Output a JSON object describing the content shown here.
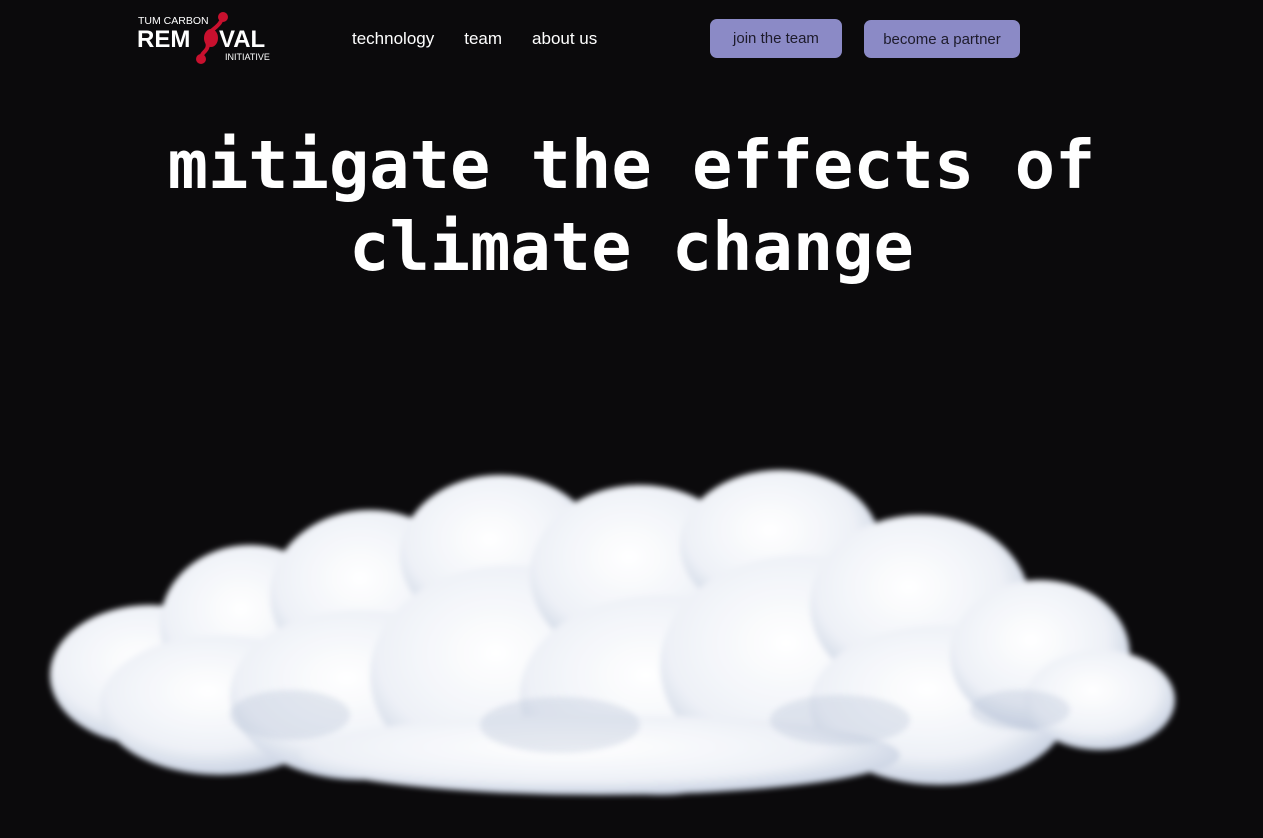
{
  "brand": {
    "logo_top": "TUM CARBON",
    "logo_main_left": "REM",
    "logo_main_right": "VAL",
    "logo_bottom": "INITIATIVE",
    "accent_color": "#c8102e"
  },
  "nav": {
    "items": [
      {
        "label": "technology"
      },
      {
        "label": "team"
      },
      {
        "label": "about us"
      }
    ]
  },
  "actions": {
    "join_label": "join the team",
    "partner_label": "become a partner",
    "button_color": "#8b8ac6"
  },
  "hero": {
    "headline_line1": "mitigate the effects of",
    "headline_line2": "climate change",
    "image_subject": "cloud-illustration"
  },
  "theme": {
    "background": "#0b0a0c",
    "text": "#ffffff"
  }
}
